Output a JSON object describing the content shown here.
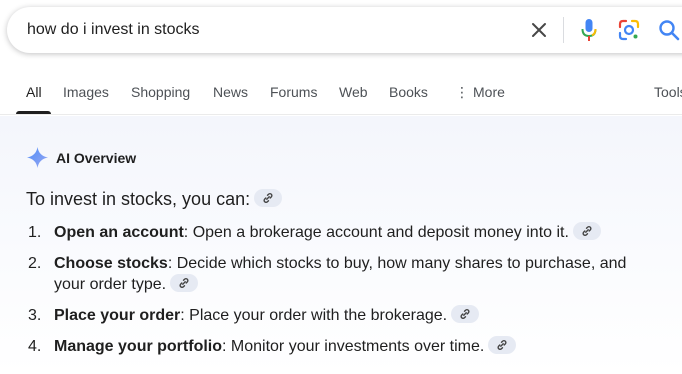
{
  "search": {
    "query": "how do i invest in stocks"
  },
  "tabs": [
    {
      "label": "All",
      "active": true
    },
    {
      "label": "Images"
    },
    {
      "label": "Shopping"
    },
    {
      "label": "News"
    },
    {
      "label": "Forums"
    },
    {
      "label": "Web"
    },
    {
      "label": "Books"
    },
    {
      "label": "More"
    },
    {
      "label": "Tools"
    }
  ],
  "overview": {
    "title": "AI Overview",
    "intro": "To invest in stocks, you can:",
    "steps": [
      {
        "number": "1.",
        "title": "Open an account",
        "text": ": Open a brokerage account and deposit money into it."
      },
      {
        "number": "2.",
        "title": "Choose stocks",
        "text": ": Decide which stocks to buy, how many shares to purchase, and your order type."
      },
      {
        "number": "3.",
        "title": "Place your order",
        "text": ": Place your order with the brokerage."
      },
      {
        "number": "4.",
        "title": "Manage your portfolio",
        "text": ": Monitor your investments over time."
      }
    ]
  },
  "icons": {
    "clear": "close-icon",
    "mic": "microphone-icon",
    "lens": "lens-camera-icon",
    "search": "search-icon",
    "sparkle": "sparkle-icon",
    "cite": "link-icon",
    "more": "more-vert-icon"
  },
  "colors": {
    "google_blue": "#4285f4",
    "google_red": "#ea4335",
    "google_yellow": "#fbbc04",
    "google_green": "#34a853",
    "overview_bg": "#f4f6fc",
    "cite_chip": "#e6eaf3"
  }
}
